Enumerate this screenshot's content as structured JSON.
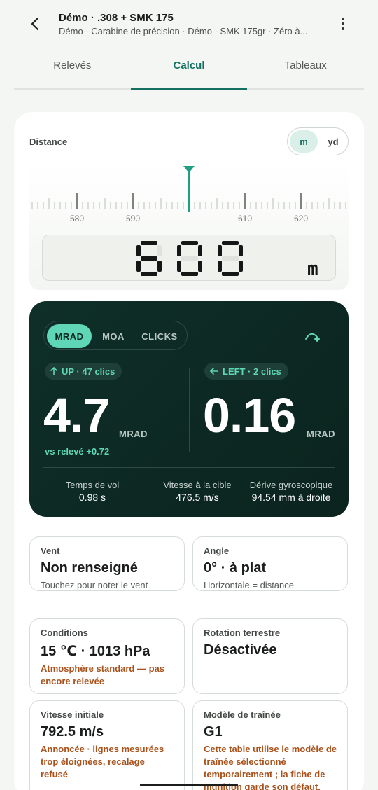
{
  "header": {
    "title": "Démo · .308 + SMK 175",
    "subtitle": "Démo · Carabine de précision · Démo · SMK 175gr · Zéro à..."
  },
  "tabs": [
    {
      "label": "Relevés",
      "active": false
    },
    {
      "label": "Calcul",
      "active": true
    },
    {
      "label": "Tableaux",
      "active": false
    }
  ],
  "distance": {
    "label": "Distance",
    "unit_m": "m",
    "unit_yd": "yd",
    "selected_unit": "m",
    "ruler_labels": [
      "580",
      "590",
      "610",
      "620"
    ],
    "display_value": "600",
    "display_unit": "m"
  },
  "correction": {
    "modes": [
      "MRAD",
      "MOA",
      "CLICKS"
    ],
    "active_mode": "MRAD",
    "vertical": {
      "chip": "UP · 47 clics",
      "value": "4.7",
      "unit": "MRAD"
    },
    "horizontal": {
      "chip": "LEFT · 2 clics",
      "value": "0.16",
      "unit": "MRAD"
    },
    "vs_releve": "vs relevé +0.72",
    "stats": [
      {
        "label": "Temps de vol",
        "value": "0.98 s"
      },
      {
        "label": "Vitesse à la cible",
        "value": "476.5 m/s"
      },
      {
        "label": "Dérive gyroscopique",
        "value": "94.54 mm à droite"
      }
    ]
  },
  "tiles": {
    "wind": {
      "label": "Vent",
      "value": "Non renseigné",
      "note": "Touchez pour noter le vent"
    },
    "angle": {
      "label": "Angle",
      "value": "0° · à plat",
      "note": "Horizontale = distance oblique"
    },
    "conditions": {
      "label": "Conditions",
      "value": "15 ℃ · 1013 hPa",
      "note": "Atmosphère standard — pas encore relevée"
    },
    "rotation": {
      "label": "Rotation terrestre",
      "value": "Désactivée"
    },
    "muzzle": {
      "label": "Vitesse initiale",
      "value": "792.5 m/s",
      "note": "Annoncée · lignes mesurées trop éloignées, recalage refusé"
    },
    "drag": {
      "label": "Modèle de traînée",
      "value": "G1",
      "note": "Cette table utilise le modèle de traînée sélectionné temporairement ; la fiche de munition garde son défaut."
    }
  },
  "colors": {
    "accent": "#137060",
    "mint": "#5fd7b6",
    "warning": "#a9521b",
    "dark_panel": "#0f2f29"
  }
}
